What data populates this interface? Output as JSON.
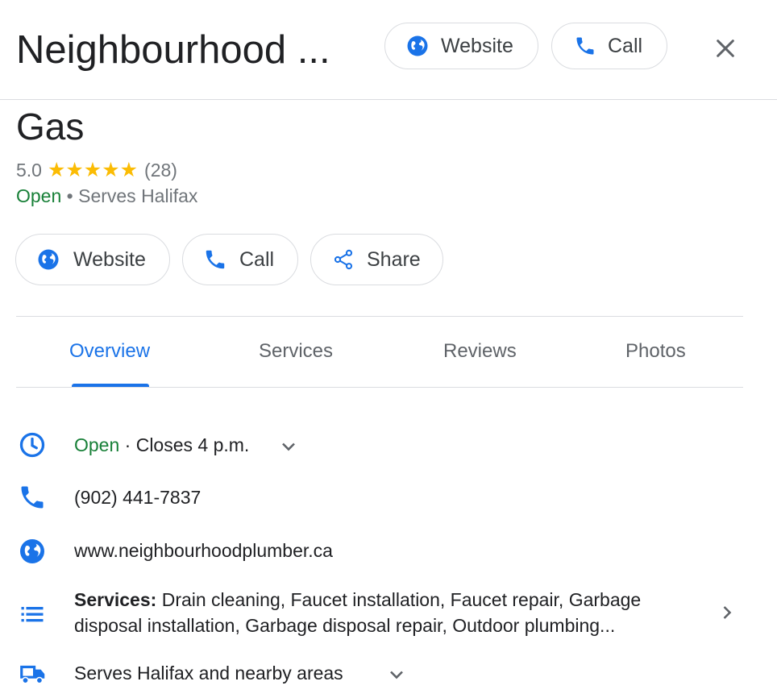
{
  "header": {
    "title": "Neighbourhood ...",
    "website_label": "Website",
    "call_label": "Call"
  },
  "business": {
    "name": "Gas",
    "rating": "5.0",
    "stars": "★★★★★",
    "review_count": "(28)",
    "open_status": "Open",
    "status_detail": " • Serves Halifax"
  },
  "actions": {
    "website_label": "Website",
    "call_label": "Call",
    "share_label": "Share"
  },
  "tabs": [
    {
      "label": "Overview",
      "active": true
    },
    {
      "label": "Services",
      "active": false
    },
    {
      "label": "Reviews",
      "active": false
    },
    {
      "label": "Photos",
      "active": false
    }
  ],
  "details": {
    "hours_open": "Open",
    "hours_closes": " · Closes 4 p.m.",
    "phone": "(902) 441-7837",
    "website": "www.neighbourhoodplumber.ca",
    "services_label": "Services:",
    "services_text": " Drain cleaning, Faucet installation, Faucet repair, Garbage disposal installation, Garbage disposal repair, Outdoor plumbing...",
    "service_area": "Serves Halifax and nearby areas"
  },
  "colors": {
    "accent_blue": "#1a73e8",
    "open_green": "#188038",
    "star_yellow": "#fbbc04"
  }
}
